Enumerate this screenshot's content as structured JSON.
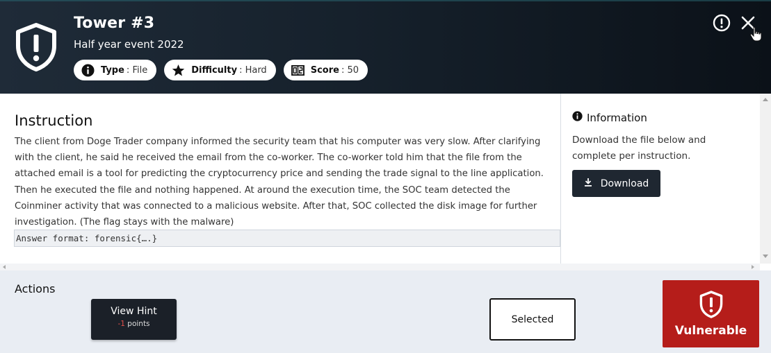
{
  "header": {
    "title": "Tower #3",
    "subtitle": "Half year event 2022",
    "badges": [
      {
        "key": "Type",
        "value": "File",
        "icon": "info-circle-icon"
      },
      {
        "key": "Difficulty",
        "value": "Hard",
        "icon": "star-icon"
      },
      {
        "key": "Score",
        "value": "50",
        "icon": "scoreboard-icon"
      }
    ],
    "report_icon": "alert-circle-icon",
    "close_icon": "close-icon"
  },
  "instruction": {
    "heading": "Instruction",
    "body": "The client from Doge Trader company informed the security team that his computer was very slow. After clarifying with the client, he said he received the email from the co-worker. The co-worker told him that the file from the attached email is a tool for predicting the cryptocurrency price and sending the trade signal to the line application. Then he executed the file and nothing happened. At around the execution time, the SOC team detected the Coinminer activity that was connected to a malicious website. After that, SOC collected the disk image for further investigation. (The flag stays with the malware)",
    "answer_format": "Answer format: forensic{….}"
  },
  "information": {
    "heading": "Information",
    "body": "Download the file below and complete per instruction.",
    "download_label": "Download"
  },
  "actions": {
    "heading": "Actions",
    "hint_label": "View Hint",
    "hint_cost_value": "-1",
    "hint_cost_unit": "points",
    "selected_label": "Selected",
    "vulnerable_label": "Vulnerable"
  },
  "colors": {
    "header_bg": "#16212c",
    "vulnerable_red": "#b51d1a",
    "dark_button": "#1f2731",
    "hint_negative": "#e3504a"
  }
}
